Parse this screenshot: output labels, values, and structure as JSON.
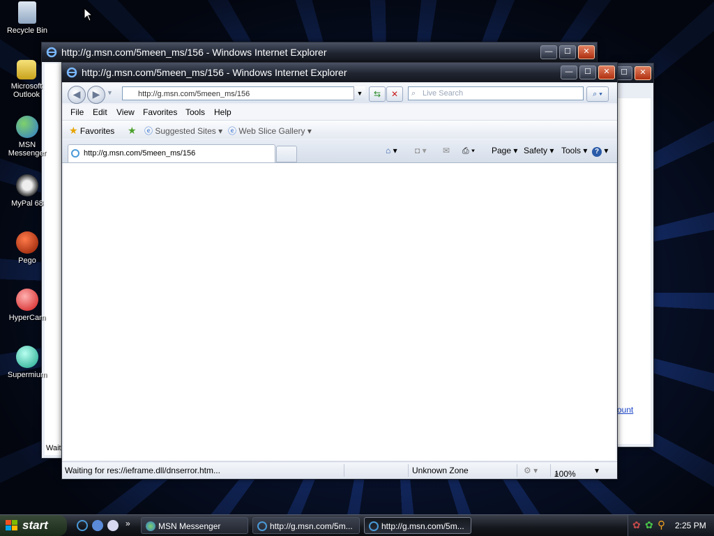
{
  "desktop": {
    "icons": [
      {
        "label": "Recycle Bin"
      },
      {
        "label": "Microsoft Outlook"
      },
      {
        "label": "MSN Messenger"
      },
      {
        "label": "MyPal 68"
      },
      {
        "label": "Pego"
      },
      {
        "label": "HyperCam"
      },
      {
        "label": "Supermium"
      }
    ]
  },
  "back_window": {
    "title": "http://g.msn.com/5meen_ms/156 - Windows Internet Explorer",
    "status_text": "Waiti",
    "link_fragment": "ount"
  },
  "main_window": {
    "title": "http://g.msn.com/5meen_ms/156 - Windows Internet Explorer",
    "address": "http://g.msn.com/5meen_ms/156",
    "search_placeholder": "Live Search",
    "menu": [
      "File",
      "Edit",
      "View",
      "Favorites",
      "Tools",
      "Help"
    ],
    "favorites_label": "Favorites",
    "suggested_sites": "Suggested Sites",
    "web_slice_gallery": "Web Slice Gallery",
    "tab_title": "http://g.msn.com/5meen_ms/156",
    "command_bar": {
      "page": "Page",
      "safety": "Safety",
      "tools": "Tools"
    },
    "status": {
      "text": "Waiting for res://ieframe.dll/dnserror.htm...",
      "zone": "Unknown Zone",
      "zoom": "100%"
    }
  },
  "taskbar": {
    "start": "start",
    "tasks": [
      {
        "label": "MSN Messenger"
      },
      {
        "label": "http://g.msn.com/5m..."
      },
      {
        "label": "http://g.msn.com/5m..."
      }
    ],
    "clock": "2:25 PM"
  }
}
